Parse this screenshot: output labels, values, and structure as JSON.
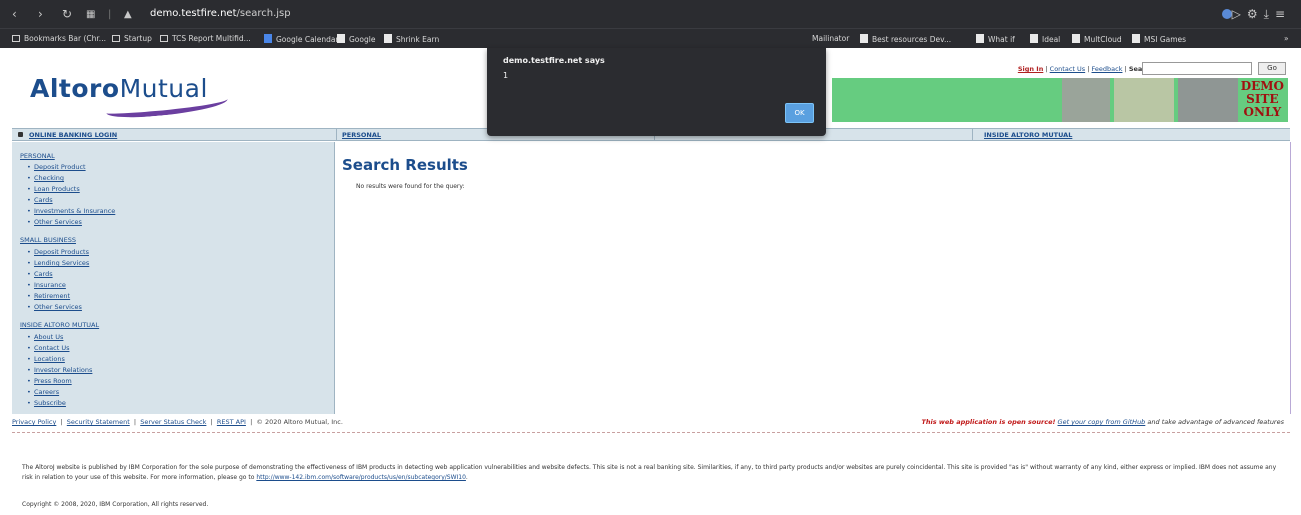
{
  "browser": {
    "url_prefix": "",
    "url_host": "demo.testfire.net",
    "url_path": "/search.jsp",
    "bookmarks": [
      {
        "label": "Bookmarks Bar (Chr...",
        "icon": "folder-icon"
      },
      {
        "label": "Startup",
        "icon": "folder-icon"
      },
      {
        "label": "TCS Report Multifid...",
        "icon": "folder-icon"
      },
      {
        "label": "Google Calendar",
        "icon": "calendar-icon"
      },
      {
        "label": "Google",
        "icon": "page-icon"
      },
      {
        "label": "Shrink Earn",
        "icon": "page-icon"
      },
      {
        "label": "Mailinator",
        "icon": "page-icon"
      },
      {
        "label": "Best resources Dev...",
        "icon": "page-icon"
      },
      {
        "label": "What if",
        "icon": "page-icon"
      },
      {
        "label": "Ideal",
        "icon": "page-icon"
      },
      {
        "label": "MultCloud",
        "icon": "page-icon"
      },
      {
        "label": "MSI Games",
        "icon": "page-icon"
      }
    ],
    "more_bookmarks": "»"
  },
  "header": {
    "logo_bold": "Altoro",
    "logo_rest": "Mutual",
    "signin": "Sign In",
    "contact": "Contact Us",
    "feedback": "Feedback",
    "search_label": "Search",
    "go_label": "Go",
    "demo_line1": "DEMO",
    "demo_line2": "SITE",
    "demo_line3": "ONLY"
  },
  "nav": {
    "login": "ONLINE BANKING LOGIN",
    "personal": "PERSONAL",
    "inside": "INSIDE ALTORO MUTUAL"
  },
  "sidebar": {
    "personal": "PERSONAL",
    "personal_items": [
      "Deposit Product",
      "Checking",
      "Loan Products",
      "Cards",
      "Investments & Insurance",
      "Other Services"
    ],
    "small_business": "SMALL BUSINESS",
    "business_items": [
      "Deposit Products",
      "Lending Services",
      "Cards",
      "Insurance",
      "Retirement",
      "Other Services"
    ],
    "inside": "INSIDE ALTORO MUTUAL",
    "inside_items": [
      "About Us",
      "Contact Us",
      "Locations",
      "Investor Relations",
      "Press Room",
      "Careers",
      "Subscribe"
    ]
  },
  "main": {
    "title": "Search Results",
    "message": "No results were found for the query:"
  },
  "footer": {
    "privacy": "Privacy Policy",
    "security": "Security Statement",
    "server": "Server Status Check",
    "rest": "REST API",
    "copyright_short": "© 2020 Altoro Mutual, Inc.",
    "open_source": "This web application is open source!",
    "get_copy": "Get your copy from GitHub",
    "advantage": "and take advantage of advanced features",
    "disclaimer": "The AltoroJ website is published by IBM Corporation for the sole purpose of demonstrating the effectiveness of IBM products in detecting web application vulnerabilities and website defects. This site is not a real banking site. Similarities, if any, to third party products and/or websites are purely coincidental. This site is provided \"as is\" without warranty of any kind, either express or implied. IBM does not assume any risk in relation to your use of this website. For more information, please go to",
    "disclaimer_link": "http://www-142.ibm.com/software/products/us/en/subcategory/SWI10",
    "copyright": "Copyright © 2008, 2020, IBM Corporation, All rights reserved."
  },
  "dialog": {
    "title": "demo.testfire.net says",
    "message": "1",
    "ok": "OK"
  }
}
